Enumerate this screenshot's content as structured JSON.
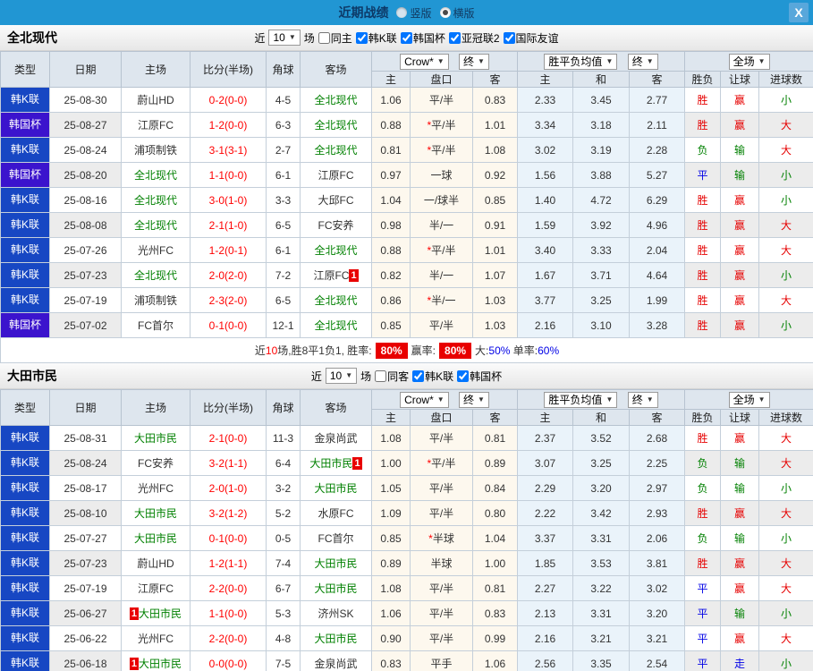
{
  "titlebar": {
    "title": "近期战绩",
    "radios": [
      {
        "label": "竖版",
        "selected": false
      },
      {
        "label": "横版",
        "selected": true
      }
    ],
    "close_label": "X"
  },
  "icons": {
    "dropdown": "▼"
  },
  "colors": {
    "titlebar_blue": "#2196d3",
    "league_kleague": "#1747c3",
    "league_kcup": "#3b14cd",
    "team_green": "#008000",
    "score_red": "#ff0000",
    "win_red": "#e60000",
    "draw_blue": "#0000e6",
    "lose_green": "#008000"
  },
  "leagues": {
    "k": "韩K联",
    "c": "韩国杯"
  },
  "result_colors": {
    "胜": "r-red",
    "平": "r-blue",
    "负": "r-green",
    "赢": "r-red",
    "走": "r-blue",
    "输": "r-green",
    "大": "r-red",
    "小": "r-green"
  },
  "columns": {
    "type": "类型",
    "date": "日期",
    "home": "主场",
    "score": "比分(半场)",
    "corner": "角球",
    "away": "客场",
    "odds_home": "主",
    "odds_handicap": "盘口",
    "odds_away": "客",
    "mean_home": "主",
    "mean_draw": "和",
    "mean_away": "客",
    "result_wdl": "胜负",
    "result_handicap": "让球",
    "result_goals": "进球数"
  },
  "selects": {
    "company": "Crow*",
    "company_final": "终",
    "mean": "胜平负均值",
    "mean_final": "终",
    "scope": "全场"
  },
  "sections": [
    {
      "team": "全北现代",
      "filter": {
        "prefix": "近",
        "count": "10",
        "suffix": "场",
        "venue_label": "同主",
        "venue_checked": false,
        "leagues": [
          {
            "label": "韩K联",
            "checked": true
          },
          {
            "label": "韩国杯",
            "checked": true
          },
          {
            "label": "亚冠联2",
            "checked": true
          },
          {
            "label": "国际友谊",
            "checked": true
          }
        ]
      },
      "rows": [
        {
          "lg": "k",
          "date": "25-08-30",
          "home": "蔚山HD",
          "hg": false,
          "hrc": 0,
          "score": "0-2(0-0)",
          "corner": "4-5",
          "away": "全北现代",
          "ag": true,
          "arc": 0,
          "o": [
            "1.06",
            "平/半",
            "0.83"
          ],
          "m": [
            "2.33",
            "3.45",
            "2.77"
          ],
          "res": [
            "胜",
            "赢",
            "小"
          ]
        },
        {
          "lg": "c",
          "date": "25-08-27",
          "home": "江原FC",
          "hg": false,
          "hrc": 0,
          "score": "1-2(0-0)",
          "corner": "6-3",
          "away": "全北现代",
          "ag": true,
          "arc": 0,
          "o": [
            "0.88",
            "*平/半",
            "1.01"
          ],
          "m": [
            "3.34",
            "3.18",
            "2.11"
          ],
          "res": [
            "胜",
            "赢",
            "大"
          ]
        },
        {
          "lg": "k",
          "date": "25-08-24",
          "home": "浦项制铁",
          "hg": false,
          "hrc": 0,
          "score": "3-1(3-1)",
          "corner": "2-7",
          "away": "全北现代",
          "ag": true,
          "arc": 0,
          "o": [
            "0.81",
            "*平/半",
            "1.08"
          ],
          "m": [
            "3.02",
            "3.19",
            "2.28"
          ],
          "res": [
            "负",
            "输",
            "大"
          ]
        },
        {
          "lg": "c",
          "date": "25-08-20",
          "home": "全北现代",
          "hg": true,
          "hrc": 0,
          "score": "1-1(0-0)",
          "corner": "6-1",
          "away": "江原FC",
          "ag": false,
          "arc": 0,
          "o": [
            "0.97",
            "一球",
            "0.92"
          ],
          "m": [
            "1.56",
            "3.88",
            "5.27"
          ],
          "res": [
            "平",
            "输",
            "小"
          ]
        },
        {
          "lg": "k",
          "date": "25-08-16",
          "home": "全北现代",
          "hg": true,
          "hrc": 0,
          "score": "3-0(1-0)",
          "corner": "3-3",
          "away": "大邱FC",
          "ag": false,
          "arc": 0,
          "o": [
            "1.04",
            "一/球半",
            "0.85"
          ],
          "m": [
            "1.40",
            "4.72",
            "6.29"
          ],
          "res": [
            "胜",
            "赢",
            "小"
          ]
        },
        {
          "lg": "k",
          "date": "25-08-08",
          "home": "全北现代",
          "hg": true,
          "hrc": 0,
          "score": "2-1(1-0)",
          "corner": "6-5",
          "away": "FC安养",
          "ag": false,
          "arc": 0,
          "o": [
            "0.98",
            "半/一",
            "0.91"
          ],
          "m": [
            "1.59",
            "3.92",
            "4.96"
          ],
          "res": [
            "胜",
            "赢",
            "大"
          ]
        },
        {
          "lg": "k",
          "date": "25-07-26",
          "home": "光州FC",
          "hg": false,
          "hrc": 0,
          "score": "1-2(0-1)",
          "corner": "6-1",
          "away": "全北现代",
          "ag": true,
          "arc": 0,
          "o": [
            "0.88",
            "*平/半",
            "1.01"
          ],
          "m": [
            "3.40",
            "3.33",
            "2.04"
          ],
          "res": [
            "胜",
            "赢",
            "大"
          ]
        },
        {
          "lg": "k",
          "date": "25-07-23",
          "home": "全北现代",
          "hg": true,
          "hrc": 0,
          "score": "2-0(2-0)",
          "corner": "7-2",
          "away": "江原FC",
          "ag": false,
          "arc": 1,
          "o": [
            "0.82",
            "半/一",
            "1.07"
          ],
          "m": [
            "1.67",
            "3.71",
            "4.64"
          ],
          "res": [
            "胜",
            "赢",
            "小"
          ]
        },
        {
          "lg": "k",
          "date": "25-07-19",
          "home": "浦项制铁",
          "hg": false,
          "hrc": 0,
          "score": "2-3(2-0)",
          "corner": "6-5",
          "away": "全北现代",
          "ag": true,
          "arc": 0,
          "o": [
            "0.86",
            "*半/一",
            "1.03"
          ],
          "m": [
            "3.77",
            "3.25",
            "1.99"
          ],
          "res": [
            "胜",
            "赢",
            "大"
          ]
        },
        {
          "lg": "c",
          "date": "25-07-02",
          "home": "FC首尔",
          "hg": false,
          "hrc": 0,
          "score": "0-1(0-0)",
          "corner": "12-1",
          "away": "全北现代",
          "ag": true,
          "arc": 0,
          "o": [
            "0.85",
            "平/半",
            "1.03"
          ],
          "m": [
            "2.16",
            "3.10",
            "3.28"
          ],
          "res": [
            "胜",
            "赢",
            "小"
          ]
        }
      ],
      "summary": {
        "parts": [
          {
            "t": "近",
            "s": "k"
          },
          {
            "t": "10",
            "s": "r"
          },
          {
            "t": "场,胜8平1负1, 胜率:",
            "s": "k"
          },
          {
            "t": "80%",
            "s": "badge"
          },
          {
            "t": "赢率:",
            "s": "k"
          },
          {
            "t": "80%",
            "s": "badge"
          },
          {
            "t": "大:",
            "s": "k"
          },
          {
            "t": "50%",
            "s": "b"
          },
          {
            "t": " 单率:",
            "s": "k"
          },
          {
            "t": "60%",
            "s": "b"
          }
        ]
      }
    },
    {
      "team": "大田市民",
      "filter": {
        "prefix": "近",
        "count": "10",
        "suffix": "场",
        "venue_label": "同客",
        "venue_checked": false,
        "leagues": [
          {
            "label": "韩K联",
            "checked": true
          },
          {
            "label": "韩国杯",
            "checked": true
          }
        ]
      },
      "rows": [
        {
          "lg": "k",
          "date": "25-08-31",
          "home": "大田市民",
          "hg": true,
          "hrc": 0,
          "score": "2-1(0-0)",
          "corner": "11-3",
          "away": "金泉尚武",
          "ag": false,
          "arc": 0,
          "o": [
            "1.08",
            "平/半",
            "0.81"
          ],
          "m": [
            "2.37",
            "3.52",
            "2.68"
          ],
          "res": [
            "胜",
            "赢",
            "大"
          ]
        },
        {
          "lg": "k",
          "date": "25-08-24",
          "home": "FC安养",
          "hg": false,
          "hrc": 0,
          "score": "3-2(1-1)",
          "corner": "6-4",
          "away": "大田市民",
          "ag": true,
          "arc": 1,
          "o": [
            "1.00",
            "*平/半",
            "0.89"
          ],
          "m": [
            "3.07",
            "3.25",
            "2.25"
          ],
          "res": [
            "负",
            "输",
            "大"
          ]
        },
        {
          "lg": "k",
          "date": "25-08-17",
          "home": "光州FC",
          "hg": false,
          "hrc": 0,
          "score": "2-0(1-0)",
          "corner": "3-2",
          "away": "大田市民",
          "ag": true,
          "arc": 0,
          "o": [
            "1.05",
            "平/半",
            "0.84"
          ],
          "m": [
            "2.29",
            "3.20",
            "2.97"
          ],
          "res": [
            "负",
            "输",
            "小"
          ]
        },
        {
          "lg": "k",
          "date": "25-08-10",
          "home": "大田市民",
          "hg": true,
          "hrc": 0,
          "score": "3-2(1-2)",
          "corner": "5-2",
          "away": "水原FC",
          "ag": false,
          "arc": 0,
          "o": [
            "1.09",
            "平/半",
            "0.80"
          ],
          "m": [
            "2.22",
            "3.42",
            "2.93"
          ],
          "res": [
            "胜",
            "赢",
            "大"
          ]
        },
        {
          "lg": "k",
          "date": "25-07-27",
          "home": "大田市民",
          "hg": true,
          "hrc": 0,
          "score": "0-1(0-0)",
          "corner": "0-5",
          "away": "FC首尔",
          "ag": false,
          "arc": 0,
          "o": [
            "0.85",
            "*半球",
            "1.04"
          ],
          "m": [
            "3.37",
            "3.31",
            "2.06"
          ],
          "res": [
            "负",
            "输",
            "小"
          ]
        },
        {
          "lg": "k",
          "date": "25-07-23",
          "home": "蔚山HD",
          "hg": false,
          "hrc": 0,
          "score": "1-2(1-1)",
          "corner": "7-4",
          "away": "大田市民",
          "ag": true,
          "arc": 0,
          "o": [
            "0.89",
            "半球",
            "1.00"
          ],
          "m": [
            "1.85",
            "3.53",
            "3.81"
          ],
          "res": [
            "胜",
            "赢",
            "大"
          ]
        },
        {
          "lg": "k",
          "date": "25-07-19",
          "home": "江原FC",
          "hg": false,
          "hrc": 0,
          "score": "2-2(0-0)",
          "corner": "6-7",
          "away": "大田市民",
          "ag": true,
          "arc": 0,
          "o": [
            "1.08",
            "平/半",
            "0.81"
          ],
          "m": [
            "2.27",
            "3.22",
            "3.02"
          ],
          "res": [
            "平",
            "赢",
            "大"
          ]
        },
        {
          "lg": "k",
          "date": "25-06-27",
          "home": "大田市民",
          "hg": true,
          "hrc": 1,
          "score": "1-1(0-0)",
          "corner": "5-3",
          "away": "济州SK",
          "ag": false,
          "arc": 0,
          "o": [
            "1.06",
            "平/半",
            "0.83"
          ],
          "m": [
            "2.13",
            "3.31",
            "3.20"
          ],
          "res": [
            "平",
            "输",
            "小"
          ]
        },
        {
          "lg": "k",
          "date": "25-06-22",
          "home": "光州FC",
          "hg": false,
          "hrc": 0,
          "score": "2-2(0-0)",
          "corner": "4-8",
          "away": "大田市民",
          "ag": true,
          "arc": 0,
          "o": [
            "0.90",
            "平/半",
            "0.99"
          ],
          "m": [
            "2.16",
            "3.21",
            "3.21"
          ],
          "res": [
            "平",
            "赢",
            "大"
          ]
        },
        {
          "lg": "k",
          "date": "25-06-18",
          "home": "大田市民",
          "hg": true,
          "hrc": 1,
          "score": "0-0(0-0)",
          "corner": "7-5",
          "away": "金泉尚武",
          "ag": false,
          "arc": 0,
          "o": [
            "0.83",
            "平手",
            "1.06"
          ],
          "m": [
            "2.56",
            "3.35",
            "2.54"
          ],
          "res": [
            "平",
            "走",
            "小"
          ]
        }
      ],
      "summary": null
    }
  ]
}
